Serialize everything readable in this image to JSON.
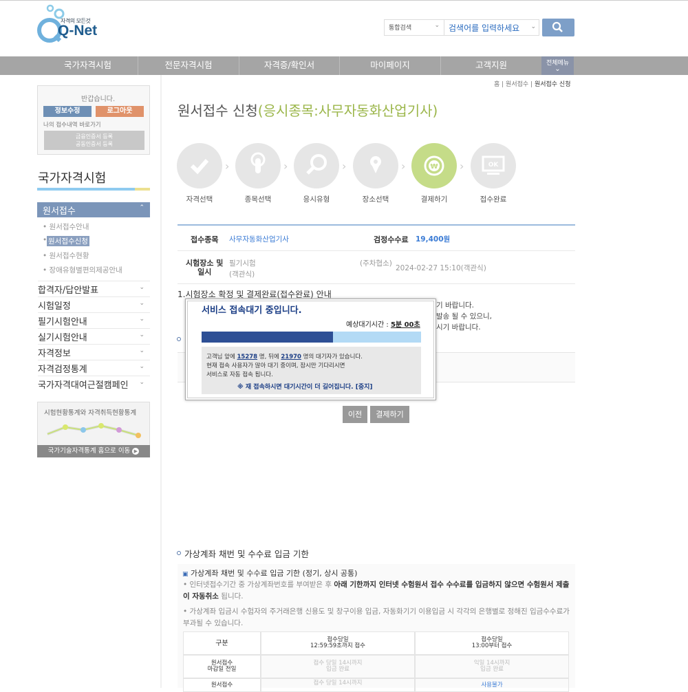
{
  "header": {
    "logo_tagline": "자격의 모든것",
    "logo_text": "Q-Net",
    "search_scope": "통합검색",
    "search_placeholder": "검색어를 입력하세요"
  },
  "nav": {
    "items": [
      "국가자격시험",
      "전문자격시험",
      "자격증/확인서",
      "마이페이지",
      "고객지원"
    ],
    "all_menu": "전체메뉴"
  },
  "sidebar": {
    "greeting": "반갑습니다.",
    "edit_info": "정보수정",
    "logout": "로그아웃",
    "my_link": "나의 접수내역 바로가기",
    "cert_btn_line1": "금융인증서 등록",
    "cert_btn_line2": "공동인증서 등록",
    "title": "국가자격시험",
    "active_menu": "원서접수",
    "sub_items": [
      "원서접수안내",
      "원서접수신청",
      "원서접수현황",
      "장애유형별편의제공안내"
    ],
    "menus": [
      "합격자/답안발표",
      "시험일정",
      "필기시험안내",
      "실기시험안내",
      "자격정보",
      "자격검정통계",
      "국가자격대여근절캠페인"
    ],
    "stats_title": "시험현황통계와 자격취득현황통계",
    "stats_btn": "국가기술자격통계 홈으로 이동"
  },
  "breadcrumb": {
    "home": "홈",
    "level1": "원서접수",
    "level2": "원서접수 신청"
  },
  "main": {
    "title_prefix": "원서접수 신청",
    "title_highlight": "(응시종목:사무자동화산업기사)",
    "steps": [
      "자격선택",
      "종목선택",
      "응시유형",
      "장소선택",
      "결제하기",
      "접수완료"
    ],
    "active_step_index": 4,
    "info": {
      "exam_label": "접수종목",
      "exam_value": "사무자동화산업기사",
      "fee_label": "검정수수료",
      "fee_value": "19,400원",
      "place_label_1": "시험장소 및",
      "place_label_2": "일시",
      "place_value_1": "필기시험",
      "place_value_2": "(객관식)",
      "place_host": "(주차협소)",
      "place_datetime": "2024-02-27 15:10(객관식)"
    },
    "guide_title": "1.시험장소 확정 및 결제완료(접수완료) 안내",
    "guide_frag_1": "기 바랍니다.",
    "guide_frag_2": "발송 될 수 있으니,",
    "guide_frag_3": "시기 바랍니다.",
    "btn_prev": "이전",
    "btn_pay": "결제하기"
  },
  "modal": {
    "title": "서비스 접속대기 중입니다.",
    "wait_label": "예상대기시간 : ",
    "wait_value": "5분 00초",
    "progress": 0.6,
    "line1_a": "고객님 앞에 ",
    "ahead": "15278",
    "line1_b": " 명, 뒤에 ",
    "behind": "21970",
    "line1_c": " 명의 대기자가 있습니다.",
    "line2": "현재 접속 사용자가 많아 대기 중이며, 잠시만 기다리시면",
    "line3": "서비스로 자동 접속 됩니다.",
    "warn": "※ 재 접속하시면 대기시간이 더 길어집니다. [중지]"
  },
  "bottom": {
    "section_title": "가상계좌 채번 및 수수료 입금 기한",
    "sub_title": "가상계좌 채번 및 수수료 입금 기한 (정기, 상시 공통)",
    "bullet1_a": "인터넷접수기간 중 가상계좌번호를 부여받은 후 ",
    "bullet1_b": "아래 기한까지 인터넷 수험원서 접수 수수료를 입금하지 않으면 수험원서 제출이 자동취소",
    "bullet1_c": " 됩니다.",
    "bullet2": "가상계좌 입금시 수험자의 주거래은행 신용도 및 창구이용 입금, 자동화기기 이용입금 시 각각의 은행별로 정해진 입금수수료가 부과될 수 있습니다.",
    "table": {
      "h0": "구분",
      "h1_a": "접수당일",
      "h1_b": "12:59:59초까지 접수",
      "h2_a": "접수당일",
      "h2_b": "13:00부터 접수",
      "r1_a": "원서접수",
      "r1_b": "마감일 전일",
      "r1_c1": "접수 당일 14시까지",
      "r1_c2": "입금 완료",
      "r1_d1": "익일 14시까지",
      "r1_d2": "입금 완료",
      "r2_a": "원서접수",
      "r2_c": "접수 당일 14시까지",
      "r2_d": "사용불가"
    }
  },
  "colors": {
    "nav_bg": "#a5a5a5",
    "title_accent": "#9bb64a",
    "active_step": "#c5dc88",
    "modal_progress": "#2d4f95"
  }
}
